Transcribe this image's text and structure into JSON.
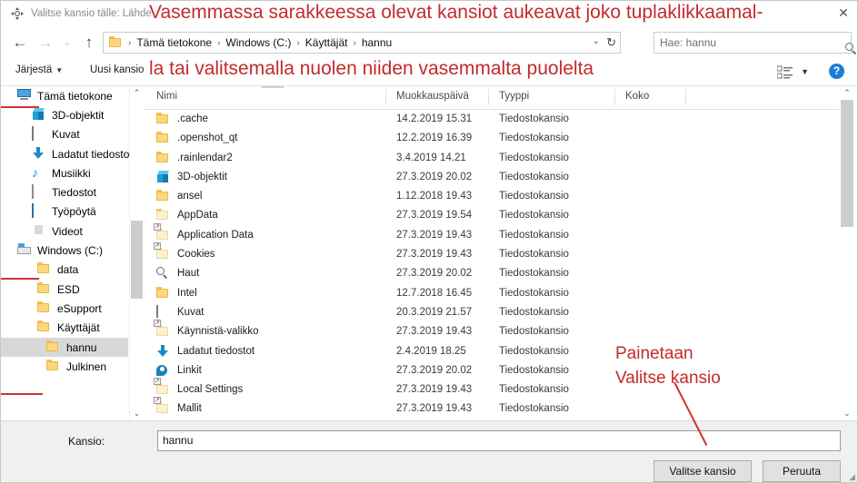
{
  "window": {
    "title": "Valitse kansio tälle: Lähde",
    "title_icon": "app-icon",
    "close_label": "✕"
  },
  "nav": {
    "back_icon": "←",
    "forward_icon": "→",
    "recent_icon": "⌄",
    "up_icon": "↑",
    "dropdown_icon": "⌄",
    "refresh_icon": "↻",
    "breadcrumbs": [
      "Tämä tietokone",
      "Windows (C:)",
      "Käyttäjät",
      "hannu"
    ],
    "separator": "›"
  },
  "search": {
    "value": "Hae: hannu",
    "icon": "search-icon"
  },
  "command_bar": {
    "sort_label": "Järjestä",
    "sort_caret": "▼",
    "new_folder_label": "Uusi kansio",
    "view_caret": "▼",
    "help_label": "?"
  },
  "tree": {
    "items": [
      {
        "label": "Tämä tietokone",
        "icon": "computer-icon",
        "indent": 18,
        "selected": false
      },
      {
        "label": "3D-objektit",
        "icon": "cube-icon",
        "indent": 34,
        "selected": false
      },
      {
        "label": "Kuvat",
        "icon": "pictures-icon",
        "indent": 34,
        "selected": false
      },
      {
        "label": "Ladatut tiedosto",
        "icon": "downloads-icon",
        "indent": 34,
        "selected": false
      },
      {
        "label": "Musiikki",
        "icon": "music-icon",
        "indent": 34,
        "selected": false
      },
      {
        "label": "Tiedostot",
        "icon": "documents-icon",
        "indent": 34,
        "selected": false
      },
      {
        "label": "Työpöytä",
        "icon": "desktop-icon",
        "indent": 34,
        "selected": false
      },
      {
        "label": "Videot",
        "icon": "videos-icon",
        "indent": 34,
        "selected": false
      },
      {
        "label": "Windows (C:)",
        "icon": "drive-icon",
        "indent": 18,
        "selected": false
      },
      {
        "label": "data",
        "icon": "folder-icon",
        "indent": 40,
        "selected": false
      },
      {
        "label": "ESD",
        "icon": "folder-icon",
        "indent": 40,
        "selected": false
      },
      {
        "label": "eSupport",
        "icon": "folder-icon",
        "indent": 40,
        "selected": false
      },
      {
        "label": "Käyttäjät",
        "icon": "folder-icon",
        "indent": 40,
        "selected": false
      },
      {
        "label": "hannu",
        "icon": "folder-icon",
        "indent": 50,
        "selected": true
      },
      {
        "label": "Julkinen",
        "icon": "folder-icon",
        "indent": 50,
        "selected": false
      }
    ],
    "scroll_up_icon": "⌃",
    "scroll_down_icon": "⌄"
  },
  "file_list": {
    "columns": [
      "Nimi",
      "Muokkauspäivä",
      "Tyyppi",
      "Koko"
    ],
    "rows": [
      {
        "name": ".cache",
        "modified": "14.2.2019 15.31",
        "type": "Tiedostokansio",
        "size": "",
        "icon": "folder-icon"
      },
      {
        "name": ".openshot_qt",
        "modified": "12.2.2019 16.39",
        "type": "Tiedostokansio",
        "size": "",
        "icon": "folder-icon"
      },
      {
        "name": ".rainlendar2",
        "modified": "3.4.2019 14.21",
        "type": "Tiedostokansio",
        "size": "",
        "icon": "folder-icon"
      },
      {
        "name": "3D-objektit",
        "modified": "27.3.2019 20.02",
        "type": "Tiedostokansio",
        "size": "",
        "icon": "cube-icon"
      },
      {
        "name": "ansel",
        "modified": "1.12.2018 19.43",
        "type": "Tiedostokansio",
        "size": "",
        "icon": "folder-icon"
      },
      {
        "name": "AppData",
        "modified": "27.3.2019 19.54",
        "type": "Tiedostokansio",
        "size": "",
        "icon": "folder-pale-icon"
      },
      {
        "name": "Application Data",
        "modified": "27.3.2019 19.43",
        "type": "Tiedostokansio",
        "size": "",
        "icon": "folder-shortcut-icon"
      },
      {
        "name": "Cookies",
        "modified": "27.3.2019 19.43",
        "type": "Tiedostokansio",
        "size": "",
        "icon": "folder-shortcut-icon"
      },
      {
        "name": "Haut",
        "modified": "27.3.2019 20.02",
        "type": "Tiedostokansio",
        "size": "",
        "icon": "search-folder-icon"
      },
      {
        "name": "Intel",
        "modified": "12.7.2018 16.45",
        "type": "Tiedostokansio",
        "size": "",
        "icon": "folder-icon"
      },
      {
        "name": "Kuvat",
        "modified": "20.3.2019 21.57",
        "type": "Tiedostokansio",
        "size": "",
        "icon": "pictures-icon"
      },
      {
        "name": "Käynnistä-valikko",
        "modified": "27.3.2019 19.43",
        "type": "Tiedostokansio",
        "size": "",
        "icon": "folder-shortcut-icon"
      },
      {
        "name": "Ladatut tiedostot",
        "modified": "2.4.2019 18.25",
        "type": "Tiedostokansio",
        "size": "",
        "icon": "downloads-icon"
      },
      {
        "name": "Linkit",
        "modified": "27.3.2019 20.02",
        "type": "Tiedostokansio",
        "size": "",
        "icon": "links-icon"
      },
      {
        "name": "Local Settings",
        "modified": "27.3.2019 19.43",
        "type": "Tiedostokansio",
        "size": "",
        "icon": "folder-shortcut-icon"
      },
      {
        "name": "Mallit",
        "modified": "27.3.2019 19.43",
        "type": "Tiedostokansio",
        "size": "",
        "icon": "folder-shortcut-icon"
      }
    ]
  },
  "footer": {
    "folder_label": "Kansio:",
    "folder_value": "hannu",
    "select_button": "Valitse kansio",
    "cancel_button": "Peruuta",
    "grip_icon": "resize-grip"
  },
  "annotations": {
    "top_line1": "Vasemmassa sarakkeessa olevat kansiot aukeavat joko tuplaklikkaamal-",
    "top_line2": "la tai valitsemalla nuolen niiden vasemmalta puolelta",
    "right_line1": "Painetaan",
    "right_line2": "Valitse kansio",
    "color": "#c32b2b"
  }
}
